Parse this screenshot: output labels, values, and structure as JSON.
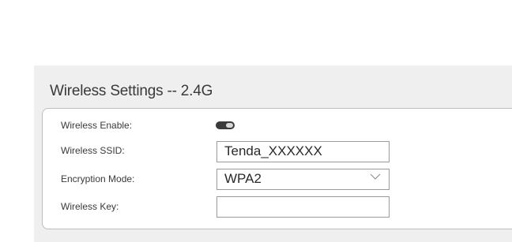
{
  "panel": {
    "title": "Wireless Settings -- 2.4G"
  },
  "form": {
    "wireless_enable": {
      "label": "Wireless Enable:",
      "enabled": true
    },
    "ssid": {
      "label": "Wireless SSID:",
      "value": "Tenda_XXXXXX"
    },
    "encryption": {
      "label": "Encryption Mode:",
      "value": "WPA2"
    },
    "key": {
      "label": "Wireless Key:",
      "value": ""
    }
  },
  "icons": {
    "toggle": "toggle-switch-icon",
    "dropdown": "chevron-down-icon"
  }
}
